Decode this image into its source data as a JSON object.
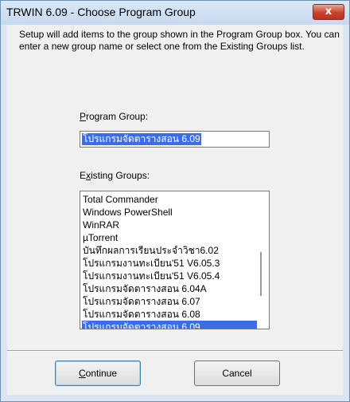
{
  "window": {
    "title": "TRWIN 6.09 - Choose Program Group",
    "close_label": "x"
  },
  "message": "Setup will add items to the group shown in the Program Group box. You can enter a new group name or select one from the Existing Groups list.",
  "program_group": {
    "label": "Program Group:",
    "value": "โปรแกรมจัดตารางสอน 6.09"
  },
  "existing_groups": {
    "label": "Existing Groups:",
    "items": [
      "Total Commander",
      "Windows PowerShell",
      "WinRAR",
      "µTorrent",
      "บันทึกผลการเรียนประจำวิชา6.02",
      "โปรแกรมงานทะเบียน'51 V6.05.3",
      "โปรแกรมงานทะเบียน'51 V6.05.4",
      "โปรแกรมจัดตารางสอน 6.04A",
      "โปรแกรมจัดตารางสอน 6.07",
      "โปรแกรมจัดตารางสอน 6.08",
      "โปรแกรมจัดตารางสอน 6.09"
    ],
    "selected_index": 10
  },
  "buttons": {
    "continue": "Continue",
    "cancel": "Cancel"
  },
  "colors": {
    "selection": "#3a6ee8",
    "close_button": "#c8432e"
  }
}
